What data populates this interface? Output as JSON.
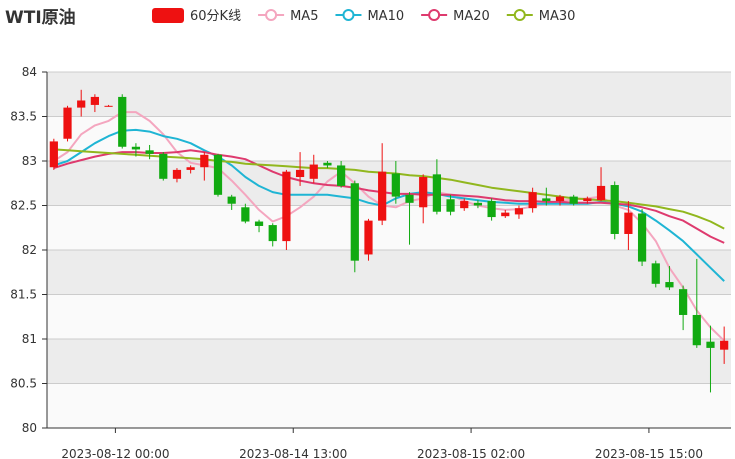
{
  "chart_data": {
    "type": "candlestick",
    "title": "WTI原油",
    "ylim": [
      80,
      84
    ],
    "yticks": [
      "80",
      "80.5",
      "81",
      "81.5",
      "82",
      "82.5",
      "83",
      "83.5",
      "84"
    ],
    "xticks": [
      {
        "label": "2023-08-12 00:00",
        "index": 5
      },
      {
        "label": "2023-08-14 13:00",
        "index": 18
      },
      {
        "label": "2023-08-15 02:00",
        "index": 31
      },
      {
        "label": "2023-08-15 15:00",
        "index": 44
      }
    ],
    "legend": [
      {
        "name": "60分K线",
        "color": "#ee1111",
        "kind": "box"
      },
      {
        "name": "MA5",
        "color": "#f4a6bf",
        "kind": "line"
      },
      {
        "name": "MA10",
        "color": "#1fb5d4",
        "kind": "line"
      },
      {
        "name": "MA20",
        "color": "#de3a6e",
        "kind": "line"
      },
      {
        "name": "MA30",
        "color": "#91b71e",
        "kind": "line"
      }
    ],
    "up_color": "#ee1111",
    "down_color": "#11aa11",
    "candles": [
      [
        82.93,
        83.22,
        82.9,
        83.25
      ],
      [
        83.25,
        83.6,
        83.22,
        83.62
      ],
      [
        83.6,
        83.68,
        83.5,
        83.8
      ],
      [
        83.63,
        83.72,
        83.55,
        83.75
      ],
      [
        83.62,
        83.62,
        83.61,
        83.63
      ],
      [
        83.72,
        83.16,
        83.14,
        83.75
      ],
      [
        83.16,
        83.13,
        83.05,
        83.2
      ],
      [
        83.12,
        83.08,
        83.02,
        83.18
      ],
      [
        83.08,
        82.8,
        82.78,
        83.1
      ],
      [
        82.8,
        82.9,
        82.76,
        82.92
      ],
      [
        82.9,
        82.93,
        82.86,
        82.95
      ],
      [
        82.93,
        83.07,
        82.78,
        83.1
      ],
      [
        83.07,
        82.62,
        82.6,
        83.08
      ],
      [
        82.6,
        82.52,
        82.45,
        82.62
      ],
      [
        82.48,
        82.32,
        82.3,
        82.52
      ],
      [
        82.32,
        82.27,
        82.2,
        82.34
      ],
      [
        82.28,
        82.1,
        82.04,
        82.3
      ],
      [
        82.1,
        82.88,
        82.0,
        82.9
      ],
      [
        82.82,
        82.9,
        82.72,
        83.1
      ],
      [
        82.8,
        82.96,
        82.75,
        83.07
      ],
      [
        82.98,
        82.95,
        82.92,
        83.0
      ],
      [
        82.95,
        82.72,
        82.7,
        83.0
      ],
      [
        82.75,
        81.88,
        81.75,
        82.78
      ],
      [
        81.95,
        82.33,
        81.88,
        82.35
      ],
      [
        82.33,
        82.88,
        82.28,
        83.2
      ],
      [
        82.86,
        82.6,
        82.52,
        83.0
      ],
      [
        82.62,
        82.53,
        82.06,
        82.65
      ],
      [
        82.48,
        82.82,
        82.3,
        82.85
      ],
      [
        82.85,
        82.43,
        82.4,
        83.02
      ],
      [
        82.57,
        82.43,
        82.39,
        82.62
      ],
      [
        82.47,
        82.55,
        82.44,
        82.58
      ],
      [
        82.53,
        82.5,
        82.47,
        82.56
      ],
      [
        82.55,
        82.37,
        82.33,
        82.58
      ],
      [
        82.38,
        82.42,
        82.36,
        82.45
      ],
      [
        82.4,
        82.47,
        82.35,
        82.5
      ],
      [
        82.47,
        82.65,
        82.42,
        82.7
      ],
      [
        82.58,
        82.55,
        82.5,
        82.7
      ],
      [
        82.55,
        82.6,
        82.5,
        82.62
      ],
      [
        82.6,
        82.52,
        82.5,
        82.62
      ],
      [
        82.55,
        82.58,
        82.52,
        82.6
      ],
      [
        82.56,
        82.72,
        82.55,
        82.93
      ],
      [
        82.73,
        82.18,
        82.12,
        82.77
      ],
      [
        82.18,
        82.42,
        82.0,
        82.55
      ],
      [
        82.41,
        81.87,
        81.82,
        82.46
      ],
      [
        81.85,
        81.62,
        81.58,
        81.88
      ],
      [
        81.64,
        81.58,
        81.55,
        81.82
      ],
      [
        81.56,
        81.27,
        81.1,
        81.6
      ],
      [
        81.27,
        80.93,
        80.9,
        81.9
      ],
      [
        80.97,
        80.9,
        80.4,
        81.15
      ],
      [
        80.88,
        80.98,
        80.72,
        81.14
      ]
    ],
    "ma": {
      "MA5": [
        83.0,
        83.1,
        83.3,
        83.4,
        83.45,
        83.55,
        83.55,
        83.45,
        83.3,
        83.1,
        82.98,
        82.95,
        82.92,
        82.78,
        82.62,
        82.45,
        82.32,
        82.38,
        82.48,
        82.6,
        82.77,
        82.88,
        82.75,
        82.6,
        82.5,
        82.48,
        82.55,
        82.58,
        82.65,
        82.62,
        82.55,
        82.5,
        82.47,
        82.45,
        82.46,
        82.49,
        82.52,
        82.55,
        82.57,
        82.58,
        82.6,
        82.5,
        82.45,
        82.3,
        82.1,
        81.8,
        81.58,
        81.32,
        81.13,
        80.98
      ],
      "MA10": [
        82.95,
        83.0,
        83.1,
        83.2,
        83.28,
        83.34,
        83.35,
        83.33,
        83.28,
        83.25,
        83.2,
        83.12,
        83.05,
        82.95,
        82.82,
        82.72,
        82.65,
        82.62,
        82.62,
        82.62,
        82.62,
        82.6,
        82.58,
        82.53,
        82.5,
        82.58,
        82.63,
        82.65,
        82.63,
        82.6,
        82.58,
        82.56,
        82.54,
        82.53,
        82.52,
        82.52,
        82.52,
        82.52,
        82.52,
        82.52,
        82.54,
        82.52,
        82.49,
        82.43,
        82.33,
        82.22,
        82.1,
        81.95,
        81.8,
        81.65
      ],
      "MA20": [
        82.92,
        82.97,
        83.01,
        83.05,
        83.08,
        83.1,
        83.1,
        83.09,
        83.09,
        83.1,
        83.12,
        83.1,
        83.07,
        83.05,
        83.02,
        82.95,
        82.88,
        82.82,
        82.78,
        82.75,
        82.73,
        82.72,
        82.7,
        82.67,
        82.65,
        82.63,
        82.63,
        82.62,
        82.62,
        82.62,
        82.61,
        82.6,
        82.58,
        82.56,
        82.55,
        82.55,
        82.54,
        82.54,
        82.53,
        82.53,
        82.53,
        82.52,
        82.51,
        82.48,
        82.44,
        82.38,
        82.33,
        82.24,
        82.15,
        82.08
      ],
      "MA30": [
        83.13,
        83.12,
        83.11,
        83.1,
        83.09,
        83.08,
        83.07,
        83.06,
        83.05,
        83.04,
        83.03,
        83.02,
        83.0,
        82.99,
        82.97,
        82.96,
        82.95,
        82.94,
        82.93,
        82.92,
        82.92,
        82.91,
        82.9,
        82.88,
        82.87,
        82.86,
        82.84,
        82.83,
        82.81,
        82.79,
        82.76,
        82.73,
        82.7,
        82.68,
        82.66,
        82.64,
        82.62,
        82.6,
        82.58,
        82.57,
        82.56,
        82.55,
        82.53,
        82.51,
        82.49,
        82.46,
        82.43,
        82.38,
        82.32,
        82.24
      ]
    }
  }
}
